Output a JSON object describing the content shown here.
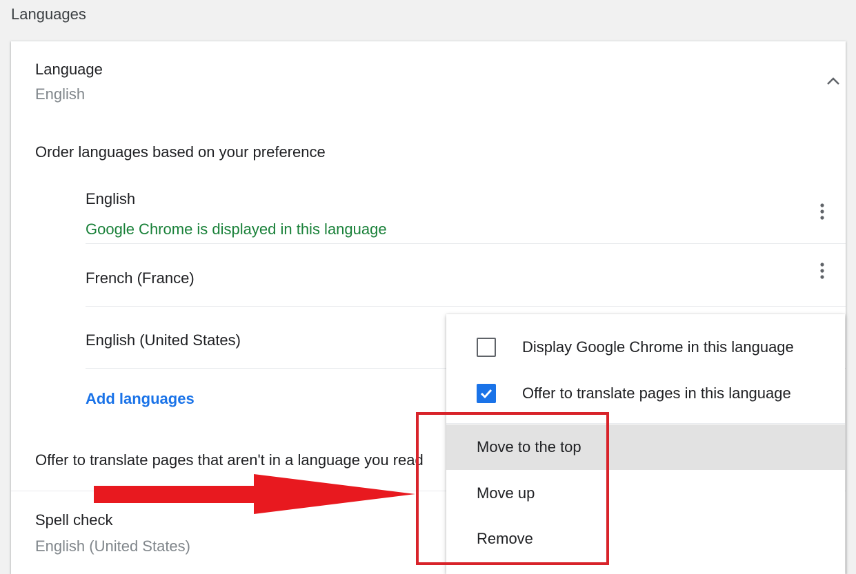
{
  "section": {
    "title": "Languages"
  },
  "language": {
    "label": "Language",
    "current": "English"
  },
  "order": {
    "label": "Order languages based on your preference",
    "items": [
      {
        "name": "English",
        "note": "Google Chrome is displayed in this language"
      },
      {
        "name": "French (France)"
      },
      {
        "name": "English (United States)"
      }
    ]
  },
  "add_languages": "Add languages",
  "offer_translate": "Offer to translate pages that aren't in a language you read",
  "spell_check": {
    "label": "Spell check",
    "value": "English (United States)"
  },
  "context_menu": {
    "options": [
      {
        "label": "Display Google Chrome in this language",
        "checked": false
      },
      {
        "label": "Offer to translate pages in this language",
        "checked": true
      }
    ],
    "items": [
      "Move to the top",
      "Move up",
      "Remove"
    ]
  },
  "colors": {
    "accent": "#1a73e8",
    "note_green": "#188038",
    "annotation_red": "#d8232a"
  }
}
